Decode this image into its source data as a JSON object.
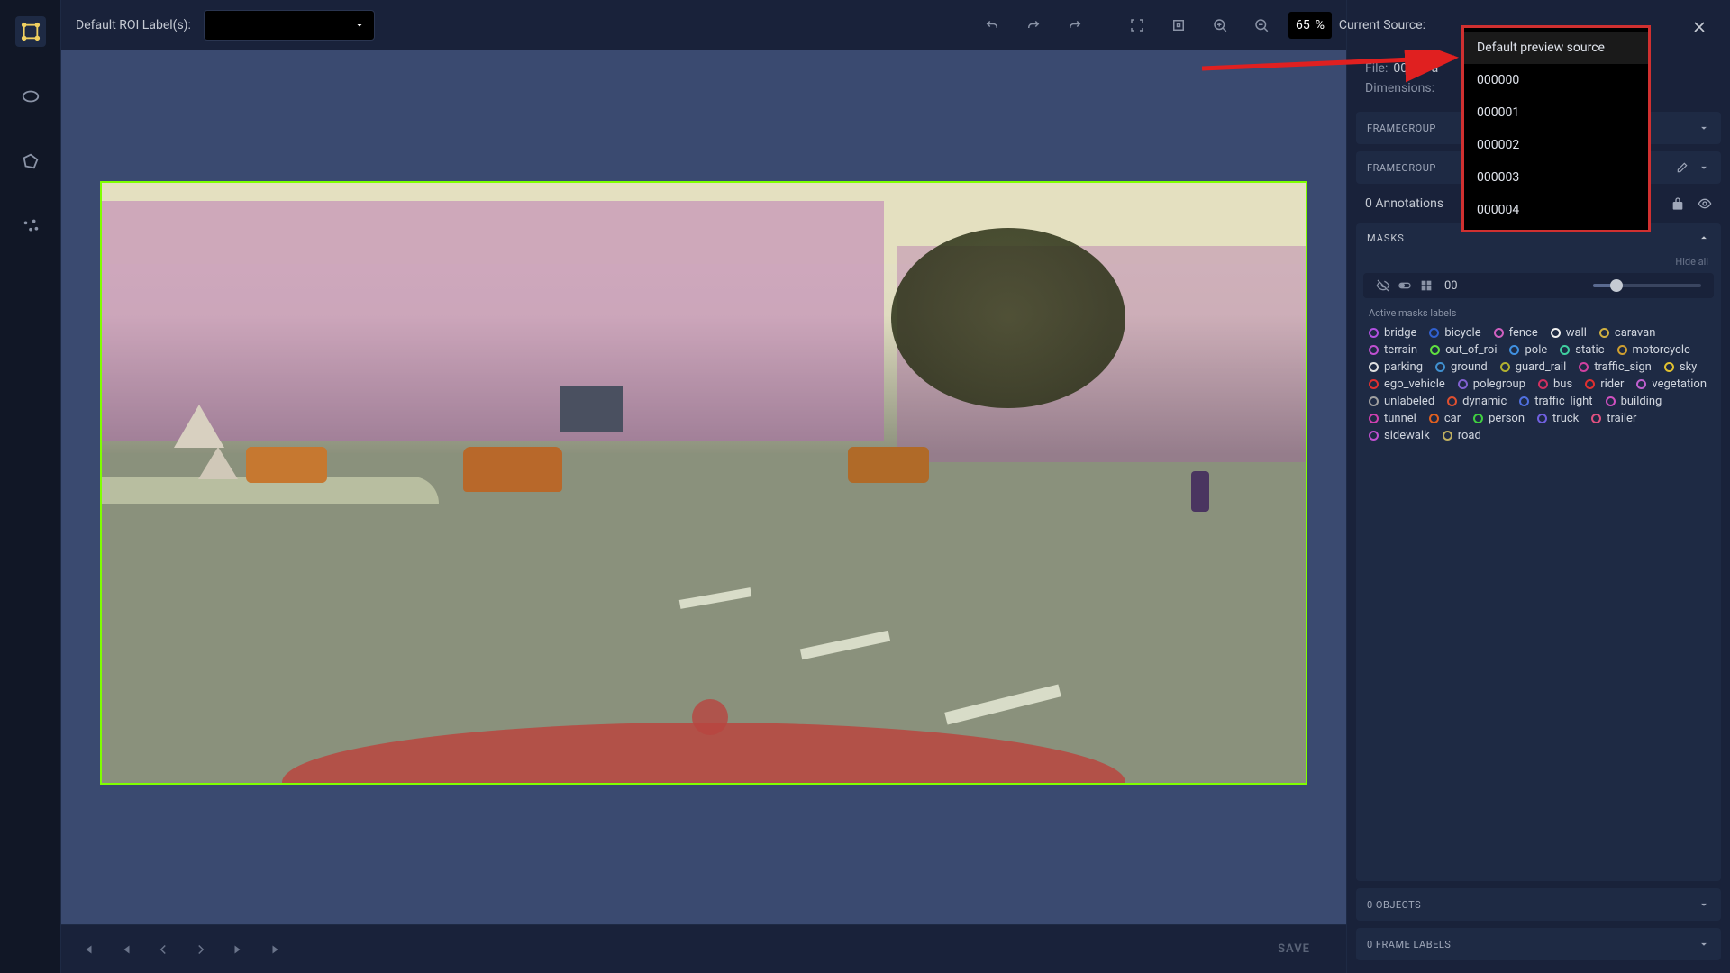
{
  "topbar": {
    "default_roi_label": "Default ROI Label(s):",
    "zoom_value": "65",
    "zoom_unit": "%",
    "current_source_label": "Current Source:"
  },
  "source_dropdown": {
    "header": "Default preview source",
    "items": [
      "000000",
      "000001",
      "000002",
      "000003",
      "000004"
    ]
  },
  "panel": {
    "file_label": "File:",
    "file_value": "0000 - a",
    "dimensions_label": "Dimensions:",
    "framegroup1": "FRAMEGROUP",
    "framegroup2": "FRAMEGROUP",
    "annotations_count": "0 Annotations",
    "masks_title": "MASKS",
    "hide_all": "Hide all",
    "mask_id": "00",
    "active_masks_label": "Active masks labels",
    "objects_title": "0 OBJECTS",
    "frame_labels_title": "0 FRAME LABELS"
  },
  "mask_labels": [
    {
      "name": "bridge",
      "color": "#b050e0"
    },
    {
      "name": "bicycle",
      "color": "#3060d0"
    },
    {
      "name": "fence",
      "color": "#d060c0"
    },
    {
      "name": "wall",
      "color": "#f0f0f0"
    },
    {
      "name": "caravan",
      "color": "#d0b040"
    },
    {
      "name": "terrain",
      "color": "#c050d0"
    },
    {
      "name": "out_of_roi",
      "color": "#60e040"
    },
    {
      "name": "pole",
      "color": "#4090e0"
    },
    {
      "name": "static",
      "color": "#40d0a0"
    },
    {
      "name": "motorcycle",
      "color": "#d0a030"
    },
    {
      "name": "parking",
      "color": "#e0e0e0"
    },
    {
      "name": "ground",
      "color": "#4090d0"
    },
    {
      "name": "guard_rail",
      "color": "#b0b030"
    },
    {
      "name": "traffic_sign",
      "color": "#d040a0"
    },
    {
      "name": "sky",
      "color": "#e0c030"
    },
    {
      "name": "ego_vehicle",
      "color": "#e03030"
    },
    {
      "name": "polegroup",
      "color": "#8060d0"
    },
    {
      "name": "bus",
      "color": "#d03060"
    },
    {
      "name": "rider",
      "color": "#e03030"
    },
    {
      "name": "vegetation",
      "color": "#c060d0"
    },
    {
      "name": "unlabeled",
      "color": "#a0a0a0"
    },
    {
      "name": "dynamic",
      "color": "#e05030"
    },
    {
      "name": "traffic_light",
      "color": "#5070e0"
    },
    {
      "name": "building",
      "color": "#d050c0"
    },
    {
      "name": "tunnel",
      "color": "#d040b0"
    },
    {
      "name": "car",
      "color": "#e06020"
    },
    {
      "name": "person",
      "color": "#40d040"
    },
    {
      "name": "truck",
      "color": "#7060e0"
    },
    {
      "name": "trailer",
      "color": "#e05080"
    },
    {
      "name": "sidewalk",
      "color": "#c050d0"
    },
    {
      "name": "road",
      "color": "#c0b060"
    }
  ],
  "bottom": {
    "save": "SAVE"
  }
}
